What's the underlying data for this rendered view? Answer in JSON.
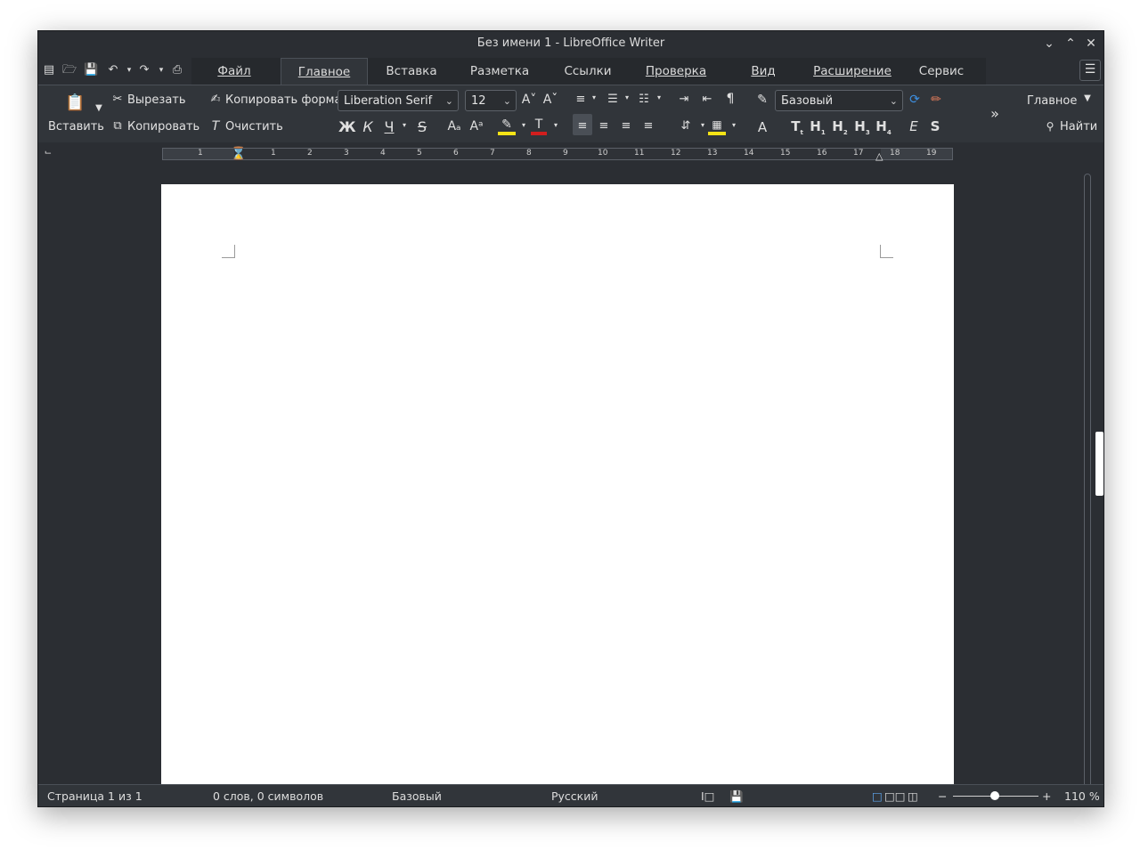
{
  "window": {
    "title": "Без имени 1 - LibreOffice Writer"
  },
  "tabs": [
    {
      "label": "Файл"
    },
    {
      "label": "Главное"
    },
    {
      "label": "Вставка"
    },
    {
      "label": "Разметка"
    },
    {
      "label": "Ссылки"
    },
    {
      "label": "Проверка"
    },
    {
      "label": "Вид"
    },
    {
      "label": "Расширение"
    },
    {
      "label": "Сервис"
    }
  ],
  "ribbon": {
    "paste_label": "Вставить",
    "cut_label": "Вырезать",
    "copy_label": "Копировать",
    "clone_label": "Копировать формат",
    "clear_label": "Очистить",
    "font_name": "Liberation Serif",
    "font_size": "12",
    "paragraph_style": "Базовый",
    "bold": "Ж",
    "italic": "К",
    "underline": "Ч",
    "strike": "S",
    "char_a": "A",
    "style_btns": [
      "T",
      "H",
      "H",
      "H",
      "H"
    ],
    "style_subs": [
      "t",
      "1",
      "2",
      "3",
      "4"
    ],
    "emph": "E",
    "strong": "S",
    "section_label": "Главное",
    "find_label": "Найти"
  },
  "ruler": {
    "labels": [
      "1",
      "1",
      "2",
      "3",
      "4",
      "5",
      "6",
      "7",
      "8",
      "9",
      "10",
      "11",
      "12",
      "13",
      "14",
      "15",
      "16",
      "17",
      "18",
      "19"
    ]
  },
  "status": {
    "page": "Страница 1 из 1",
    "words": "0 слов, 0 символов",
    "style": "Базовый",
    "language": "Русский",
    "zoom_minus": "−",
    "zoom_plus": "+",
    "zoom": "110 %"
  }
}
